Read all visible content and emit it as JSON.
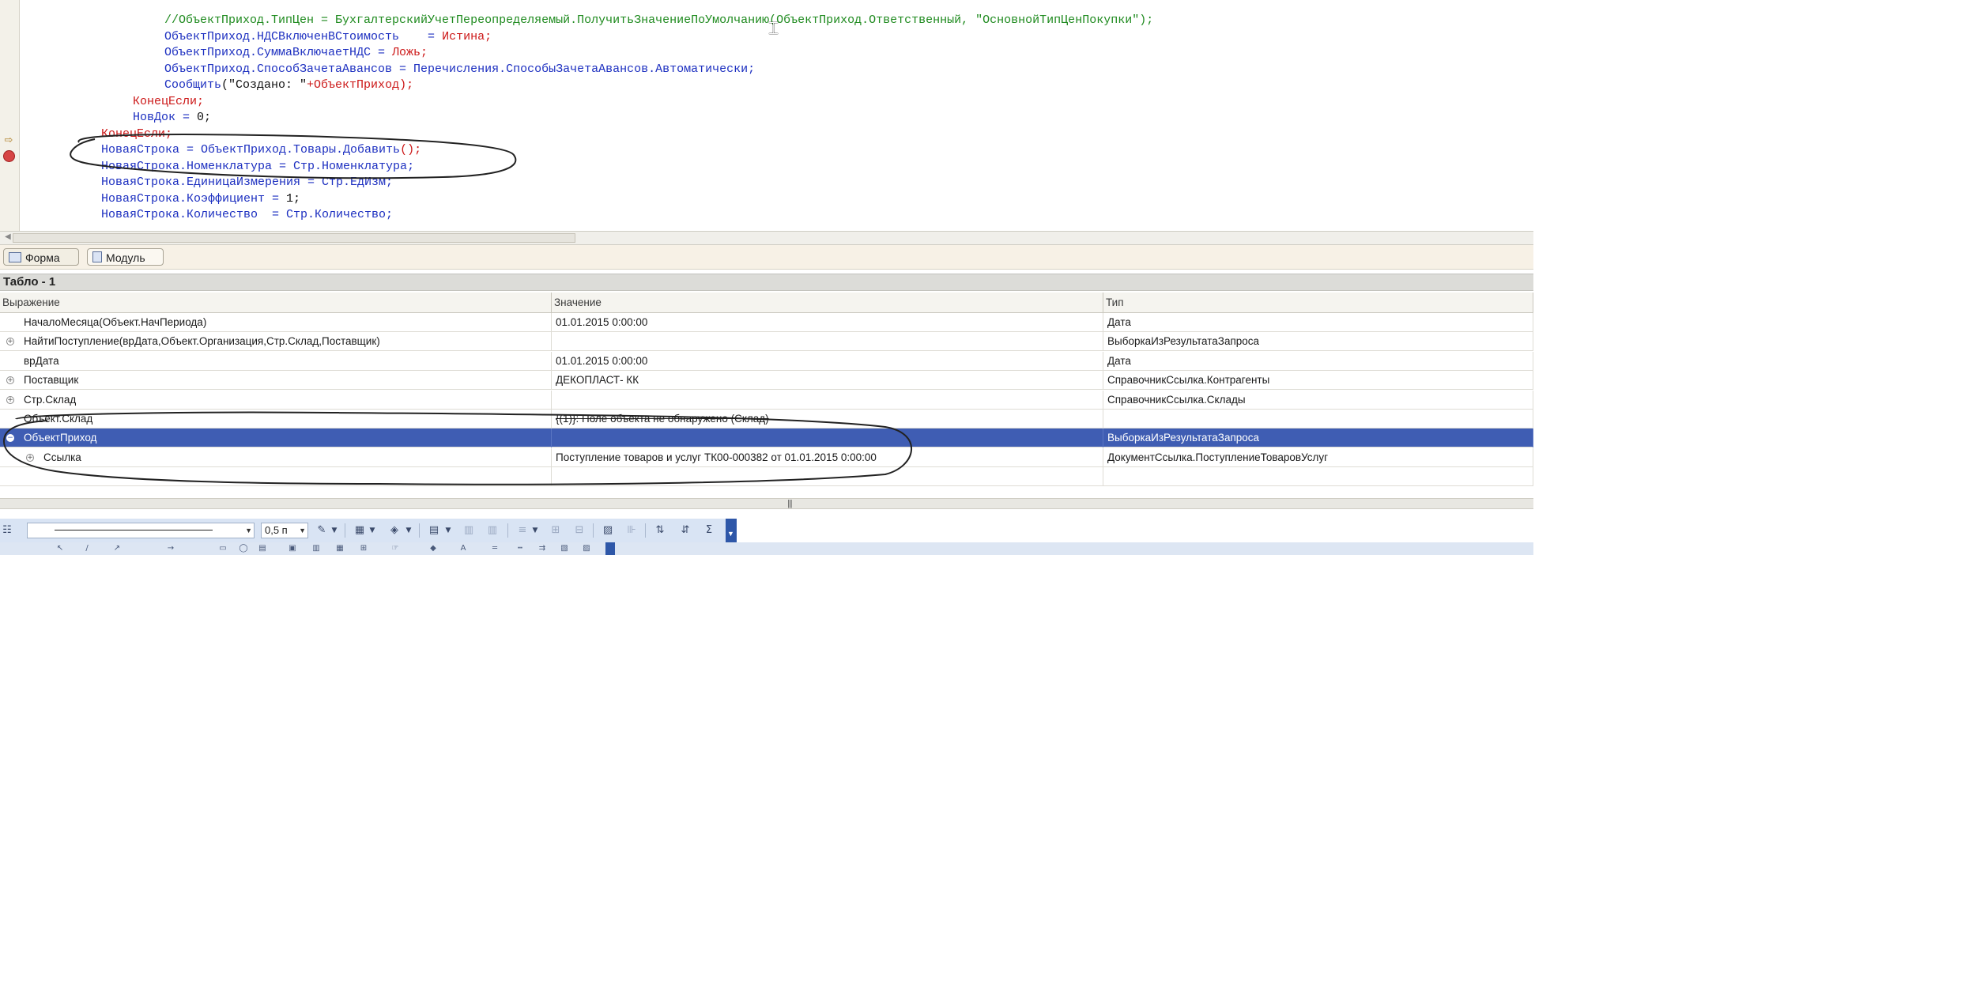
{
  "editor": {
    "lines": [
      {
        "indent": "        ",
        "segments": [
          {
            "t": "//ОбъектПриход.ТипЦен = БухгалтерскийУчетПереопределяемый.ПолучитьЗначениеПоУмолчанию(ОбъектПриход.Ответственный, \"ОсновнойТипЦенПокупки\");",
            "c": "green"
          }
        ]
      },
      {
        "indent": "        ",
        "segments": [
          {
            "t": "ОбъектПриход.НДСВключенВСтоимость    = ",
            "c": "blue"
          },
          {
            "t": "Истина;",
            "c": "red"
          }
        ]
      },
      {
        "indent": "        ",
        "segments": [
          {
            "t": "ОбъектПриход.СуммаВключаетНДС = ",
            "c": "blue"
          },
          {
            "t": "Ложь;",
            "c": "red"
          }
        ]
      },
      {
        "indent": "        ",
        "segments": [
          {
            "t": "ОбъектПриход.СпособЗачетаАвансов = Перечисления.СпособыЗачетаАвансов.Автоматически;",
            "c": "blue"
          }
        ]
      },
      {
        "indent": "        ",
        "segments": [
          {
            "t": "Сообщить",
            "c": "blue"
          },
          {
            "t": "(\"Создано: \"",
            "c": "black"
          },
          {
            "t": "+ОбъектПриход);",
            "c": "red"
          }
        ]
      },
      {
        "indent": "    ",
        "segments": [
          {
            "t": "КонецЕсли;",
            "c": "red"
          }
        ]
      },
      {
        "indent": "    ",
        "segments": [
          {
            "t": "НовДок = ",
            "c": "blue"
          },
          {
            "t": "0;",
            "c": "black"
          }
        ]
      },
      {
        "indent": "",
        "segments": [
          {
            "t": "КонецЕсли;",
            "c": "red"
          }
        ]
      },
      {
        "indent": "",
        "segments": [
          {
            "t": "НоваяСтрока = ОбъектПриход.Товары.Добавить",
            "c": "blue"
          },
          {
            "t": "();",
            "c": "red"
          }
        ]
      },
      {
        "indent": "",
        "segments": [
          {
            "t": "НоваяСтрока.Номенклатура = Стр.Номенклатура;",
            "c": "blue"
          }
        ]
      },
      {
        "indent": "",
        "segments": [
          {
            "t": "НоваяСтрока.ЕдиницаИзмерения = Стр.ЕдИзм;",
            "c": "blue"
          }
        ]
      },
      {
        "indent": "",
        "segments": [
          {
            "t": "НоваяСтрока.Коэффициент = ",
            "c": "blue"
          },
          {
            "t": "1;",
            "c": "black"
          }
        ]
      },
      {
        "indent": "",
        "segments": [
          {
            "t": "НоваяСтрока.Количество  = Стр.Количество;",
            "c": "blue"
          }
        ]
      }
    ]
  },
  "tabs": {
    "form": "Форма",
    "module": "Модуль"
  },
  "tablo": {
    "title": "Табло - 1",
    "columns": {
      "expression": "Выражение",
      "value": "Значение",
      "type": "Тип"
    },
    "rows": [
      {
        "expr": "НачалоМесяца(Объект.НачПериода)",
        "value": "01.01.2015 0:00:00",
        "type": "Дата",
        "expandable": false,
        "level": 0
      },
      {
        "expr": "НайтиПоступление(врДата,Объект.Организация,Стр.Склад,Поставщик)",
        "value": "",
        "type": "ВыборкаИзРезультатаЗапроса",
        "expandable": true,
        "level": 0
      },
      {
        "expr": "врДата",
        "value": "01.01.2015 0:00:00",
        "type": "Дата",
        "expandable": false,
        "level": 0
      },
      {
        "expr": "Поставщик",
        "value": "ДЕКОПЛАСТ- КК",
        "type": "СправочникСсылка.Контрагенты",
        "expandable": true,
        "level": 0
      },
      {
        "expr": "Стр.Склад",
        "value": "",
        "type": "СправочникСсылка.Склады",
        "expandable": true,
        "level": 0
      },
      {
        "expr": "Объект.Склад",
        "value": "{(1)}: Поле объекта не обнаружено (Склад)",
        "type": "",
        "expandable": false,
        "level": 0,
        "error": true
      },
      {
        "expr": "ОбъектПриход",
        "value": "",
        "type": "ВыборкаИзРезультатаЗапроса",
        "expandable": true,
        "expanded": true,
        "selected": true,
        "level": 0
      },
      {
        "expr": "Ссылка",
        "value": "Поступление товаров и услуг ТК00-000382 от 01.01.2015 0:00:00",
        "type": "ДокументСсылка.ПоступлениеТоваровУслуг",
        "expandable": true,
        "level": 1
      },
      {
        "expr": "",
        "value": "",
        "type": "",
        "expandable": false,
        "level": 0
      }
    ]
  },
  "toolbar": {
    "line_width": "0,5 п"
  },
  "colors": {
    "selection": "#3f5db3",
    "keyword_red": "#cc1818",
    "identifier_blue": "#1c2fc0",
    "comment_green": "#1e8a1e",
    "breakpoint": "#d64545"
  }
}
